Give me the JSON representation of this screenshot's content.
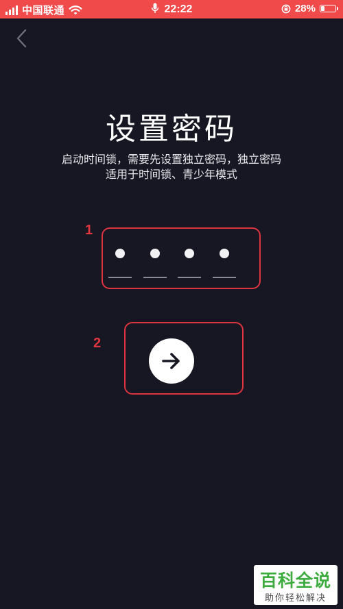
{
  "status_bar": {
    "carrier": "中国联通",
    "time": "22:22",
    "battery_percent": "28%",
    "battery_level": 0.28,
    "bg_color": "#f04a4a"
  },
  "nav": {
    "back_icon": "chevron-left-icon"
  },
  "header": {
    "title": "设置密码",
    "description_line1": "启动时间锁，需要先设置独立密码，独立密码",
    "description_line2": "适用于时间锁、青少年模式"
  },
  "pin": {
    "length": 4,
    "filled": 4
  },
  "annotations": {
    "label1": "1",
    "label2": "2",
    "color": "#e0343f"
  },
  "next_button": {
    "icon": "arrow-right-icon"
  },
  "watermark": {
    "main": "百科全说",
    "sub": "助你轻松解决"
  }
}
